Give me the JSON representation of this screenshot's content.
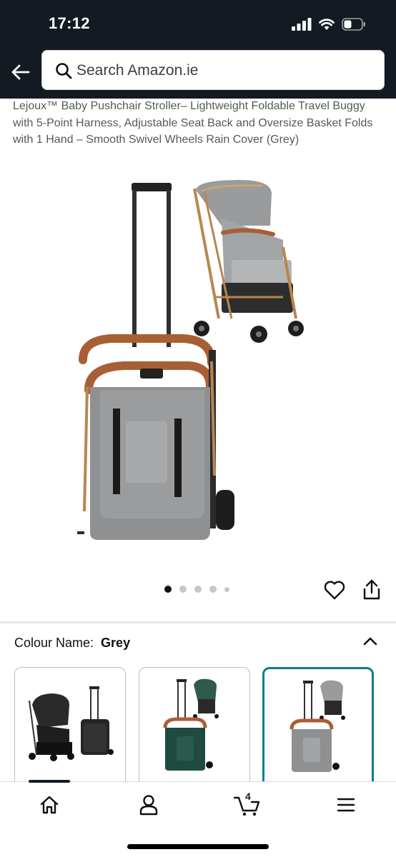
{
  "status_bar": {
    "time": "17:12",
    "icons": [
      "signal-icon",
      "wifi-icon",
      "battery-icon"
    ]
  },
  "header": {
    "back_icon": "arrow-left-icon",
    "search": {
      "placeholder": "Search Amazon.ie",
      "icon": "search-icon"
    }
  },
  "product": {
    "title": "Lejoux™ Baby Pushchair Stroller– Lightweight Foldable Travel Buggy with 5-Point Harness, Adjustable Seat Back and Oversize Basket Folds with 1 Hand – Smooth Swivel Wheels Rain Cover (Grey)",
    "image_carousel": {
      "total_dots": 5,
      "active_index": 0
    },
    "actions": [
      "heart-icon",
      "share-icon"
    ]
  },
  "colour": {
    "label": "Colour Name:",
    "value": "Grey",
    "options": [
      {
        "name": "Black",
        "color": "#2a2a2a"
      },
      {
        "name": "Green",
        "color": "#1f4a40"
      },
      {
        "name": "Grey",
        "color": "#8d8d8d"
      }
    ],
    "selected_index": 2
  },
  "bottom_nav": {
    "items": [
      {
        "icon": "home-icon"
      },
      {
        "icon": "account-icon"
      },
      {
        "icon": "cart-icon",
        "count": "4"
      },
      {
        "icon": "menu-icon"
      }
    ]
  },
  "colors": {
    "header_bg": "#131a22",
    "selected_border": "#0a7d8c",
    "frame_tan": "#b9764a",
    "fabric_grey": "#8f9092"
  }
}
